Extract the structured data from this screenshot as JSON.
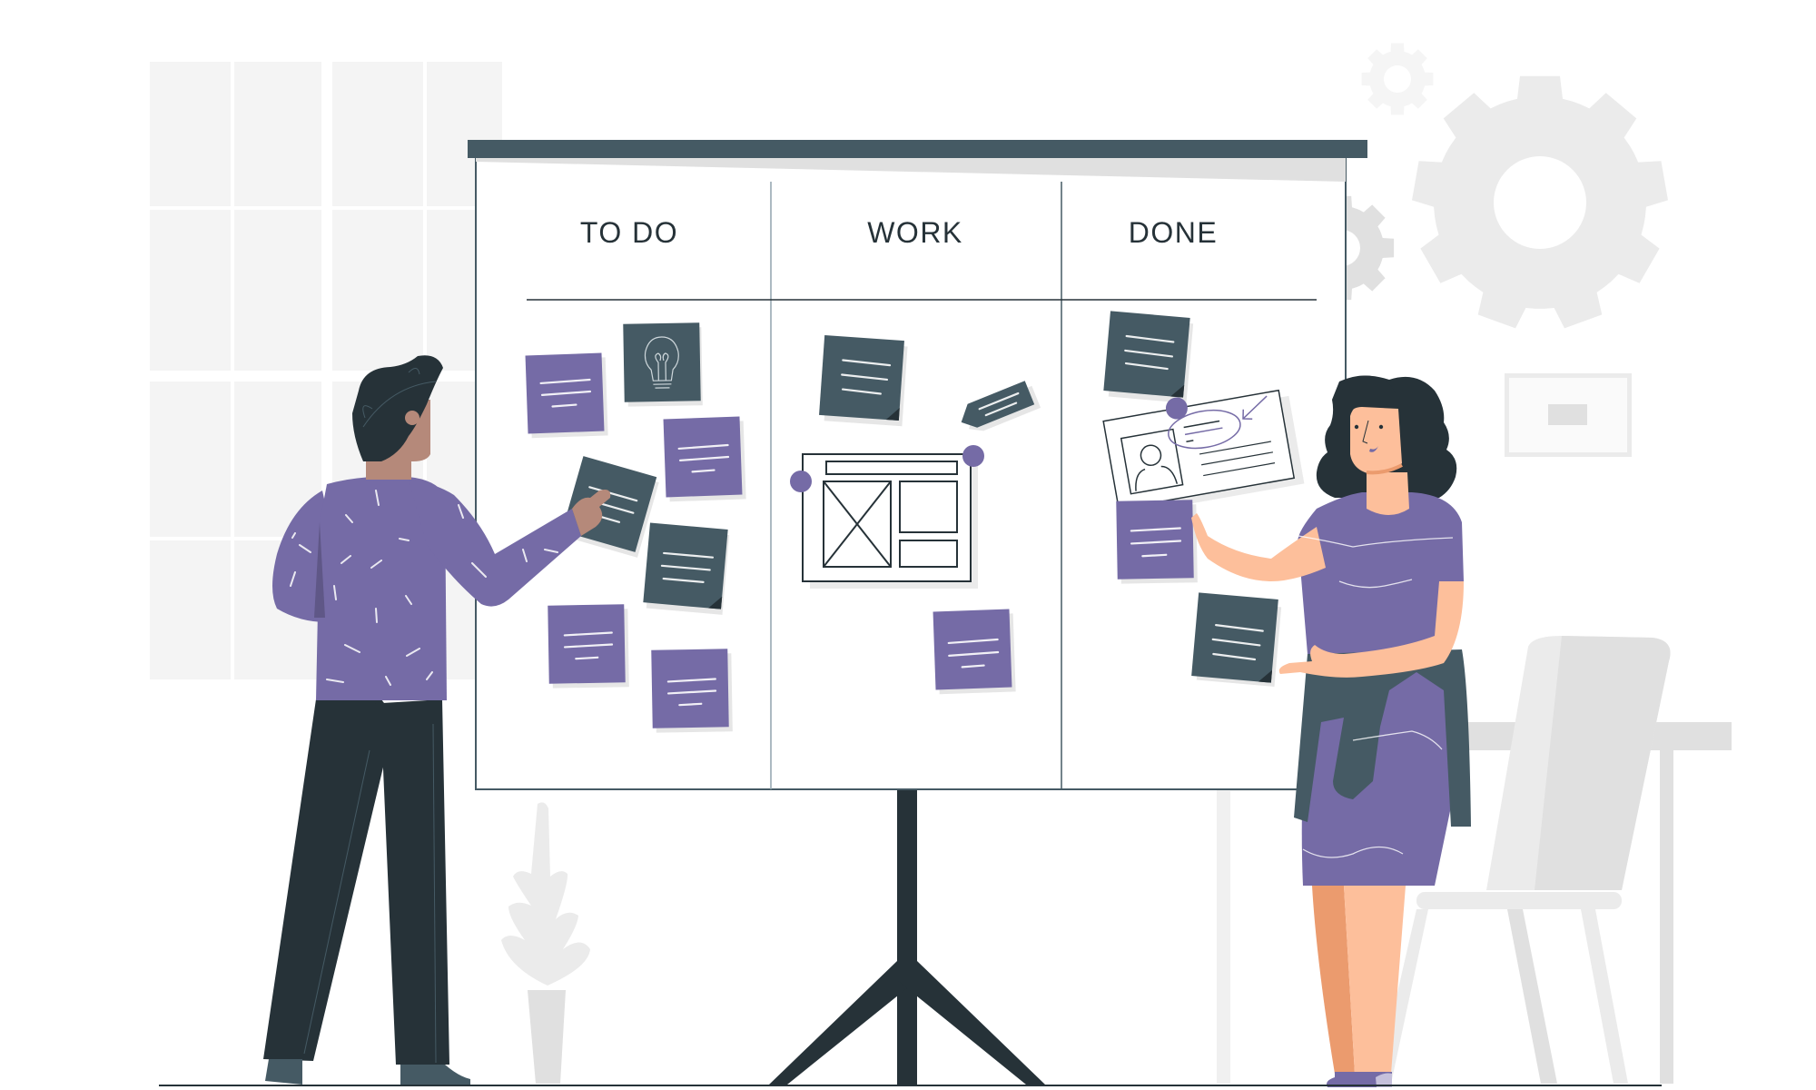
{
  "scene": {
    "title": "Kanban board illustration",
    "board": {
      "columns": [
        {
          "id": "todo",
          "label": "TO DO",
          "notes": [
            {
              "color": "purple",
              "lines": 3
            },
            {
              "color": "dark",
              "icon": "lightbulb-icon"
            },
            {
              "color": "purple",
              "lines": 3
            },
            {
              "color": "dark",
              "lines": 3
            },
            {
              "color": "dark",
              "lines": 3
            },
            {
              "color": "purple",
              "lines": 3
            },
            {
              "color": "purple",
              "lines": 3
            }
          ]
        },
        {
          "id": "work",
          "label": "WORK",
          "notes": [
            {
              "color": "dark",
              "lines": 3
            },
            {
              "color": "dark",
              "shape": "tag",
              "lines": 2
            },
            {
              "color": "white",
              "kind": "wireframe-card"
            },
            {
              "color": "purple",
              "lines": 3
            }
          ]
        },
        {
          "id": "done",
          "label": "DONE",
          "notes": [
            {
              "color": "dark",
              "lines": 3
            },
            {
              "color": "white",
              "kind": "profile-card"
            },
            {
              "color": "purple",
              "lines": 3
            },
            {
              "color": "dark",
              "lines": 3
            }
          ]
        }
      ]
    },
    "people": [
      {
        "role": "man-pointing-at-board"
      },
      {
        "role": "woman-holding-notes"
      }
    ],
    "decor": [
      "window",
      "gears",
      "picture-frame",
      "desk",
      "chair",
      "plant",
      "board-stand"
    ]
  },
  "colors": {
    "purple": "#756ba6",
    "purple_dark": "#5f5787",
    "dark": "#455a64",
    "ink": "#263238",
    "skin_man": "#b5897a",
    "skin_woman": "#fdbf9b",
    "skin_woman_shade": "#eb9b6e",
    "light_gray": "#f4f4f4",
    "mid_gray": "#ebebeb",
    "gray": "#e0e0e0"
  }
}
